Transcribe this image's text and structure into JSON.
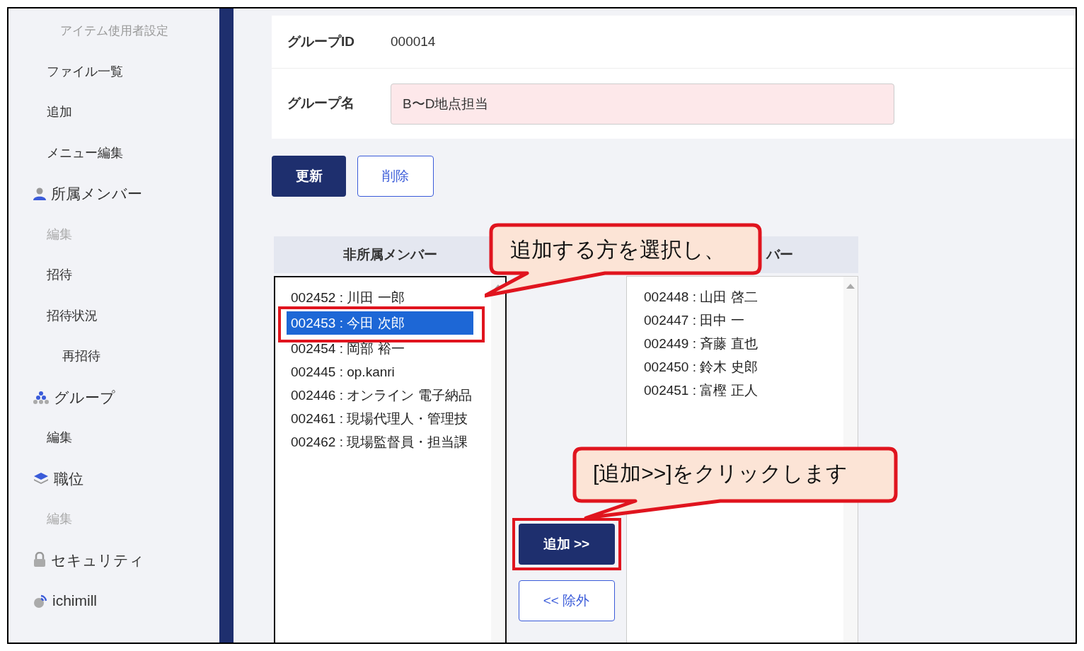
{
  "sidebar": {
    "items": [
      {
        "text": "アイテム使用者設定",
        "kind": "title"
      },
      {
        "text": "ファイル一覧",
        "kind": "link",
        "disabled": false
      },
      {
        "text": "追加",
        "kind": "link",
        "disabled": false
      },
      {
        "text": "メニュー編集",
        "kind": "link",
        "disabled": false
      },
      {
        "text": "所属メンバー",
        "kind": "section",
        "children": [
          {
            "text": "編集",
            "disabled": true
          },
          {
            "text": "招待",
            "disabled": false
          },
          {
            "text": "招待状況",
            "disabled": false,
            "children": [
              {
                "text": "再招待",
                "disabled": false
              }
            ]
          }
        ]
      },
      {
        "text": "グループ",
        "kind": "section",
        "children": [
          {
            "text": "編集",
            "disabled": false
          }
        ]
      },
      {
        "text": "職位",
        "kind": "section",
        "children": [
          {
            "text": "編集",
            "disabled": true
          }
        ]
      },
      {
        "text": "セキュリティ",
        "kind": "section"
      },
      {
        "text": "ichimill",
        "kind": "section"
      }
    ]
  },
  "form": {
    "fields": [
      {
        "label": "グループID",
        "kind": "static",
        "value": "000014"
      },
      {
        "label": "グループ名",
        "kind": "input",
        "value": "B〜D地点担当"
      }
    ],
    "buttons": [
      {
        "label": "更新",
        "kind": "primary"
      },
      {
        "label": "削除",
        "kind": "outline"
      }
    ]
  },
  "members": {
    "left": {
      "header": "非所属メンバー",
      "items": [
        {
          "text": "002452 : 川田 一郎",
          "selected": false
        },
        {
          "text": "002453 : 今田 次郎",
          "selected": true
        },
        {
          "text": "002454 : 岡部 裕一",
          "selected": false
        },
        {
          "text": "002445 : op.kanri",
          "selected": false
        },
        {
          "text": "002446 : オンライン 電子納品",
          "selected": false
        },
        {
          "text": "002461 : 現場代理人・管理技",
          "selected": false
        },
        {
          "text": "002462 : 現場監督員・担当課",
          "selected": false
        }
      ]
    },
    "right": {
      "header": "バー",
      "items": [
        {
          "text": "002448 : 山田 啓二",
          "selected": false
        },
        {
          "text": "002447 : 田中 一",
          "selected": false
        },
        {
          "text": "002449 : 斉藤 直也",
          "selected": false
        },
        {
          "text": "002450 : 鈴木 史郎",
          "selected": false
        },
        {
          "text": "002451 : 富樫 正人",
          "selected": false
        }
      ]
    },
    "actions": [
      {
        "label": "追加 >>",
        "kind": "primary",
        "highlighted": true
      },
      {
        "label": "<< 除外",
        "kind": "outline",
        "highlighted": false
      }
    ]
  },
  "callouts": [
    {
      "text": "追加する方を選択し、"
    },
    {
      "text": "[追加>>]をクリックします"
    }
  ]
}
